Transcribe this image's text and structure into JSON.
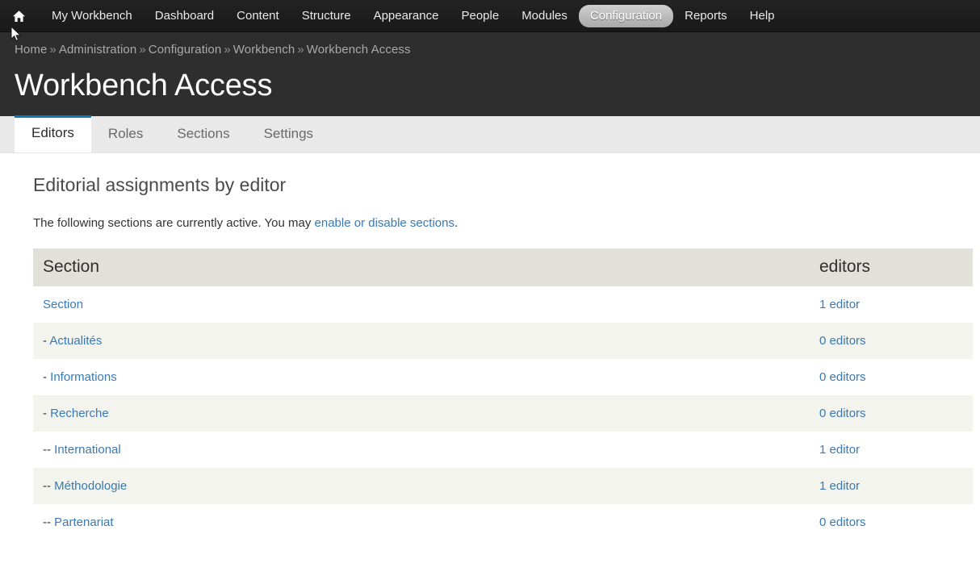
{
  "toolbar": {
    "home_icon": "home-icon",
    "items": [
      {
        "label": "My Workbench",
        "active": false
      },
      {
        "label": "Dashboard",
        "active": false
      },
      {
        "label": "Content",
        "active": false
      },
      {
        "label": "Structure",
        "active": false
      },
      {
        "label": "Appearance",
        "active": false
      },
      {
        "label": "People",
        "active": false
      },
      {
        "label": "Modules",
        "active": false
      },
      {
        "label": "Configuration",
        "active": true
      },
      {
        "label": "Reports",
        "active": false
      },
      {
        "label": "Help",
        "active": false
      }
    ]
  },
  "breadcrumb": {
    "separator": "»",
    "items": [
      "Home",
      "Administration",
      "Configuration",
      "Workbench",
      "Workbench Access"
    ]
  },
  "page": {
    "title": "Workbench Access"
  },
  "tabs": [
    {
      "label": "Editors",
      "active": true
    },
    {
      "label": "Roles",
      "active": false
    },
    {
      "label": "Sections",
      "active": false
    },
    {
      "label": "Settings",
      "active": false
    }
  ],
  "main": {
    "heading": "Editorial assignments by editor",
    "intro_before": "The following sections are currently active. You may ",
    "intro_link": "enable or disable sections",
    "intro_after": "."
  },
  "table": {
    "columns": [
      "Section",
      "editors"
    ],
    "rows": [
      {
        "indent": "",
        "section": "Section",
        "editors": "1 editor"
      },
      {
        "indent": "- ",
        "section": "Actualités",
        "editors": "0 editors"
      },
      {
        "indent": "- ",
        "section": "Informations",
        "editors": "0 editors"
      },
      {
        "indent": "- ",
        "section": "Recherche",
        "editors": "0 editors"
      },
      {
        "indent": "-- ",
        "section": "International",
        "editors": "1 editor"
      },
      {
        "indent": "-- ",
        "section": "Méthodologie",
        "editors": "1 editor"
      },
      {
        "indent": "-- ",
        "section": "Partenariat",
        "editors": "0 editors"
      }
    ]
  },
  "colors": {
    "header_bg": "#2e2e2e",
    "toolbar_bg": "#1f1f1f",
    "active_tab_border": "#0c78b5",
    "link": "#3979b4",
    "table_header_bg": "#e1e1da",
    "row_alt_bg": "#f4f4ee"
  }
}
